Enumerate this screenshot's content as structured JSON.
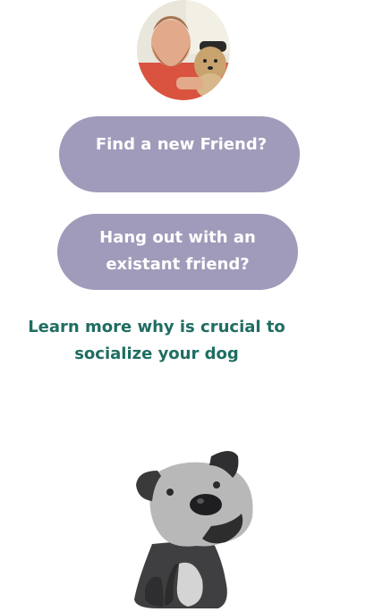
{
  "profile": {
    "avatar_alt": "Man with beard holding a small dog"
  },
  "actions": {
    "find_friend_label": "Find a new Friend?",
    "hang_out_label": "Hang out with an existant friend?"
  },
  "info": {
    "learn_more_label": "Learn more why is crucial to socialize your dog"
  },
  "colors": {
    "button_bg": "#a09bba",
    "button_text": "#ffffff",
    "link_text": "#1f6d62",
    "background": "#ffffff"
  },
  "illustration": {
    "icon": "dog-mascot-icon"
  }
}
